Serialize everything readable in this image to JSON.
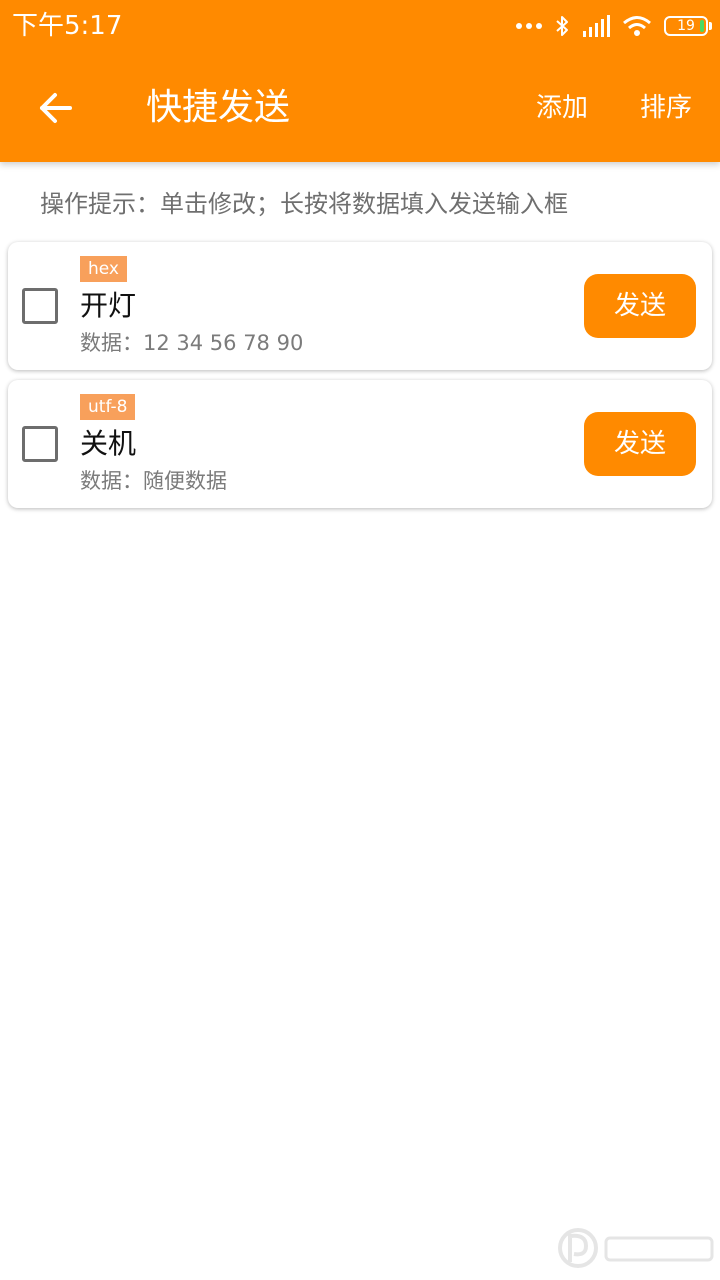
{
  "status_bar": {
    "time": "下午5:17",
    "battery_level": "19",
    "icons": [
      "more-dots-icon",
      "bluetooth-icon",
      "signal-icon",
      "wifi-icon",
      "battery-icon"
    ]
  },
  "app_bar": {
    "back_icon": "back-arrow-icon",
    "title": "快捷发送",
    "add_label": "添加",
    "sort_label": "排序"
  },
  "hint": "操作提示：单击修改；长按将数据填入发送输入框",
  "items": [
    {
      "encoding": "hex",
      "name": "开灯",
      "data": "数据：12 34 56 78 90",
      "send_label": "发送",
      "checked": false
    },
    {
      "encoding": "utf-8",
      "name": "关机",
      "data": "数据：随便数据",
      "send_label": "发送",
      "checked": false
    }
  ],
  "colors": {
    "accent": "#FF8A00",
    "badge": "#F8A05B",
    "hint_text": "#6F6F6F",
    "battery_fill": "#4CD964"
  }
}
